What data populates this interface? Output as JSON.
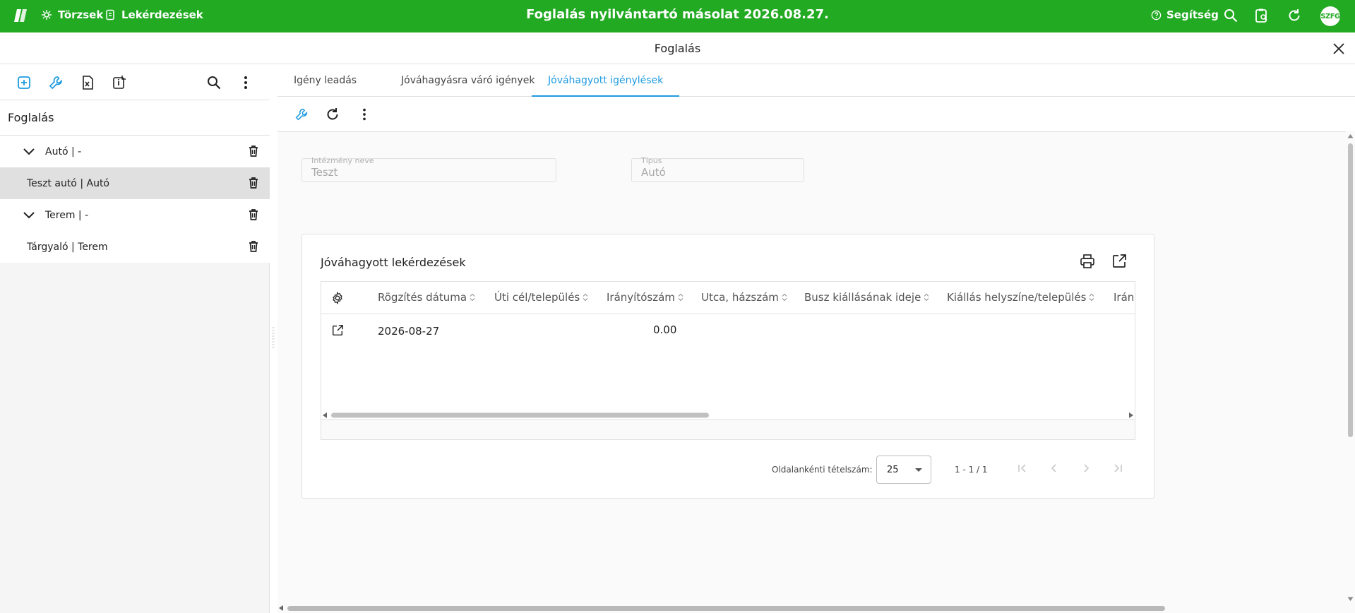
{
  "topbar": {
    "nav": [
      {
        "label": "Törzsek",
        "icon": "settings-icon"
      },
      {
        "label": "Lekérdezések",
        "icon": "report-icon"
      }
    ],
    "title": "Foglalás nyilvántartó másolat 2026.08.27.",
    "help_label": "Segítség",
    "avatar_text": "SZFG",
    "brand_color": "#22aa22"
  },
  "page": {
    "title": "Foglalás"
  },
  "sidebar": {
    "heading": "Foglalás",
    "items": [
      {
        "label": "Autó | -",
        "expandable": true
      },
      {
        "label": "Teszt autó | Autó",
        "expandable": false,
        "selected": true
      },
      {
        "label": "Terem | -",
        "expandable": true
      },
      {
        "label": "Tárgyaló | Terem",
        "expandable": false
      }
    ]
  },
  "tabs": [
    {
      "label": "Igény leadás"
    },
    {
      "label": "Jóváhagyásra váró igények"
    },
    {
      "label": "Jóváhagyott igénylések",
      "active": true
    }
  ],
  "fields": {
    "institution": {
      "label": "Intézmény neve",
      "value": "Teszt"
    },
    "type": {
      "label": "Típus",
      "value": "Autó"
    }
  },
  "card": {
    "title": "Jóváhagyott lekérdezések",
    "columns": [
      "Rögzítés dátuma",
      "Úti cél/település",
      "Irányítószám",
      "Utca, házszám",
      "Busz kiállásának ideje",
      "Kiállás helyszíne/település",
      "Irán"
    ],
    "rows": [
      {
        "date": "2026-08-27",
        "zip": "0.00"
      }
    ]
  },
  "pager": {
    "page_size_label": "Oldalankénti tételszám:",
    "page_size": "25",
    "range": "1 - 1 / 1"
  },
  "accent_color": "#1e9be0"
}
